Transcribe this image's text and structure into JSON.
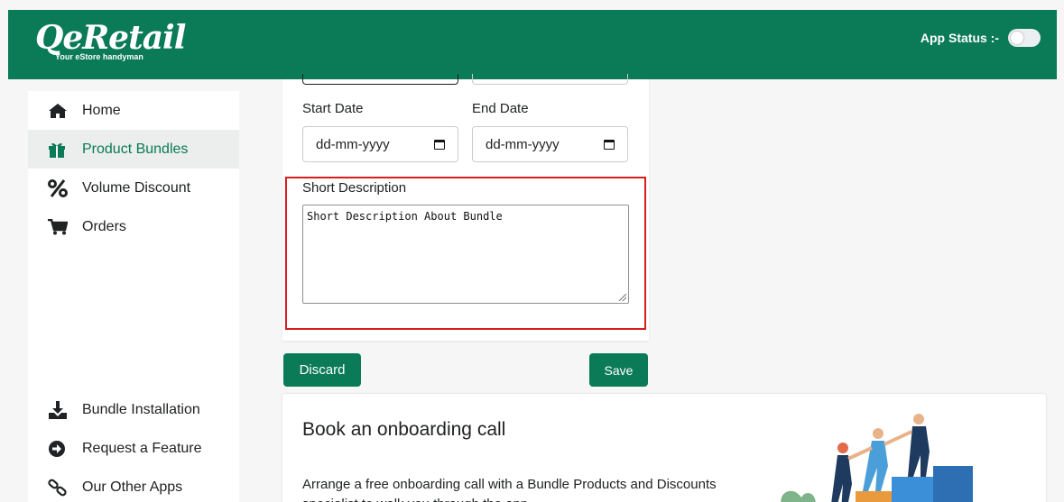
{
  "header": {
    "logo_text": "QeRetail",
    "logo_tagline": "Your eStore handyman",
    "app_status_label": "App Status :-",
    "app_status_enabled": false
  },
  "sidebar": {
    "items": [
      {
        "label": "Home",
        "icon": "home-icon"
      },
      {
        "label": "Product Bundles",
        "icon": "gift-icon",
        "active": true
      },
      {
        "label": "Volume Discount",
        "icon": "percent-icon"
      },
      {
        "label": "Orders",
        "icon": "cart-icon"
      }
    ],
    "bottom_items": [
      {
        "label": "Bundle Installation",
        "icon": "download-icon"
      },
      {
        "label": "Request a Feature",
        "icon": "arrow-circle-right-icon"
      },
      {
        "label": "Our Other Apps",
        "icon": "link-icon"
      }
    ]
  },
  "form": {
    "start_date_label": "Start Date",
    "start_date_value": "dd-mm-yyyy",
    "end_date_label": "End Date",
    "end_date_value": "dd-mm-yyyy",
    "short_description_label": "Short Description",
    "short_description_value": "Short Description About Bundle",
    "highlight_color": "#d91c1c"
  },
  "actions": {
    "discard_label": "Discard",
    "save_label": "Save",
    "accent_color": "#0b7a57"
  },
  "onboarding": {
    "title": "Book an onboarding call",
    "text": "Arrange a free onboarding call with a Bundle Products and Discounts specialist to walk you through the app."
  }
}
